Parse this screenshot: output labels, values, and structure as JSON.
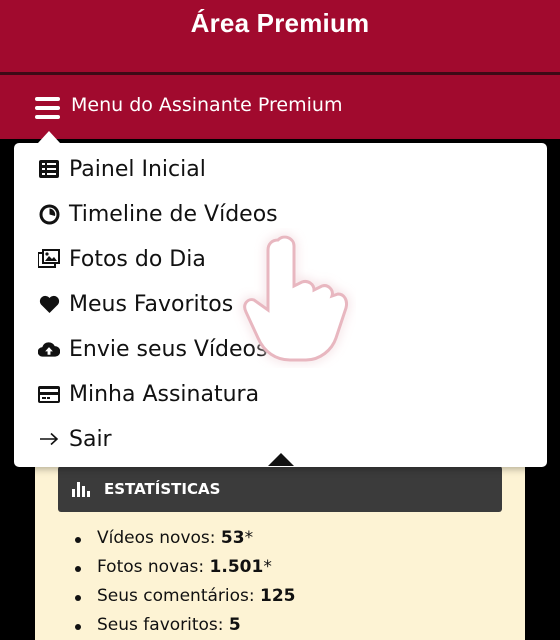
{
  "header": {
    "title": "Área Premium"
  },
  "menubar": {
    "label": "Menu do Assinante Premium"
  },
  "menu": {
    "items": [
      {
        "label": "Painel Inicial",
        "icon": "list-icon"
      },
      {
        "label": "Timeline de Vídeos",
        "icon": "clock-icon"
      },
      {
        "label": "Fotos do Dia",
        "icon": "images-icon"
      },
      {
        "label": "Meus Favoritos",
        "icon": "heart-icon"
      },
      {
        "label": "Envie seus Vídeos",
        "icon": "cloud-upload-icon"
      },
      {
        "label": "Minha Assinatura",
        "icon": "credit-card-icon"
      },
      {
        "label": "Sair",
        "icon": "arrow-right-icon"
      }
    ]
  },
  "stats": {
    "title": "ESTATÍSTICAS",
    "items": [
      {
        "label": "Vídeos novos: ",
        "value": "53",
        "suffix": "*"
      },
      {
        "label": "Fotos novas: ",
        "value": "1.501",
        "suffix": "*"
      },
      {
        "label": "Seus comentários: ",
        "value": "125",
        "suffix": ""
      },
      {
        "label": "Seus favoritos: ",
        "value": "5",
        "suffix": ""
      }
    ]
  },
  "colors": {
    "brand": "#a10a2e",
    "card": "#fdf3d4",
    "stats_header": "#3b3b3b"
  }
}
